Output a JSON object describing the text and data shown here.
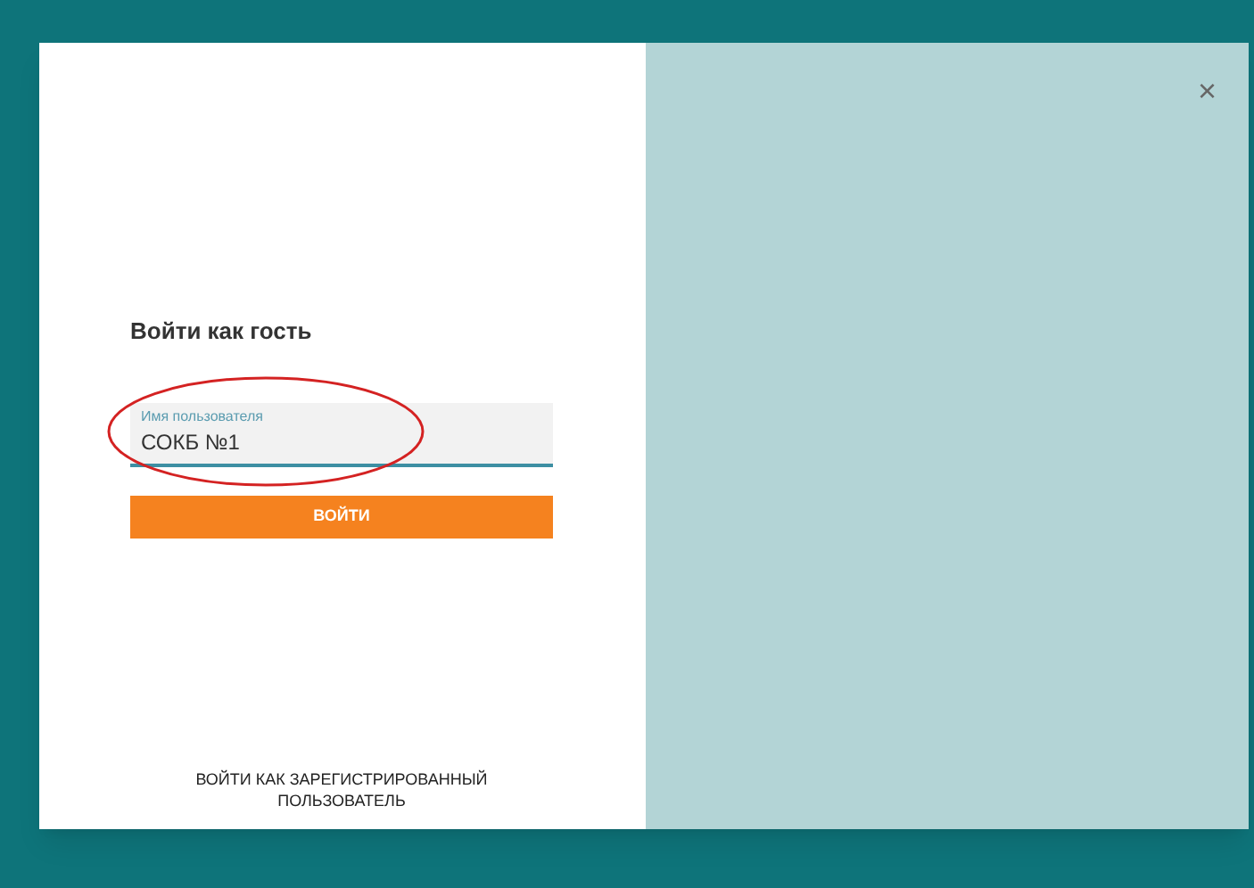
{
  "dialog": {
    "title": "Войти как гость",
    "username_field": {
      "label": "Имя пользователя",
      "value": "СОКБ №1"
    },
    "submit_button": "ВОЙТИ",
    "registered_login_link": "ВОЙТИ КАК ЗАРЕГИСТРИРОВАННЫЙ ПОЛЬЗОВАТЕЛЬ",
    "close_button": "×"
  }
}
